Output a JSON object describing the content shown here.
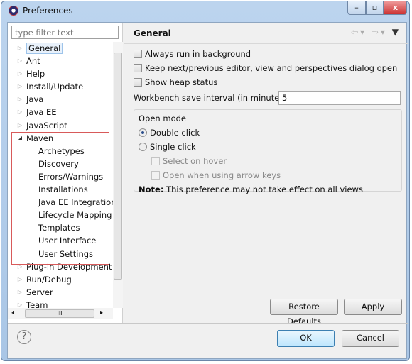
{
  "window": {
    "title": "Preferences",
    "minimize": "–",
    "maximize": "▫",
    "close": "x"
  },
  "filter": {
    "placeholder": "type filter text"
  },
  "tree": [
    {
      "label": "General",
      "level": 0,
      "expanded": false,
      "selected": true
    },
    {
      "label": "Ant",
      "level": 0,
      "expanded": false
    },
    {
      "label": "Help",
      "level": 0,
      "expanded": false
    },
    {
      "label": "Install/Update",
      "level": 0,
      "expanded": false
    },
    {
      "label": "Java",
      "level": 0,
      "expanded": false
    },
    {
      "label": "Java EE",
      "level": 0,
      "expanded": false
    },
    {
      "label": "JavaScript",
      "level": 0,
      "expanded": false
    },
    {
      "label": "Maven",
      "level": 0,
      "expanded": true
    },
    {
      "label": "Archetypes",
      "level": 1
    },
    {
      "label": "Discovery",
      "level": 1
    },
    {
      "label": "Errors/Warnings",
      "level": 1
    },
    {
      "label": "Installations",
      "level": 1
    },
    {
      "label": "Java EE Integration",
      "level": 1
    },
    {
      "label": "Lifecycle Mapping",
      "level": 1
    },
    {
      "label": "Templates",
      "level": 1
    },
    {
      "label": "User Interface",
      "level": 1
    },
    {
      "label": "User Settings",
      "level": 1
    },
    {
      "label": "Plug-in Development",
      "level": 0,
      "expanded": false
    },
    {
      "label": "Run/Debug",
      "level": 0,
      "expanded": false
    },
    {
      "label": "Server",
      "level": 0,
      "expanded": false
    },
    {
      "label": "Team",
      "level": 0,
      "expanded": false
    }
  ],
  "page": {
    "title": "General",
    "always_run_bg": "Always run in background",
    "keep_editor": "Keep next/previous editor, view and perspectives dialog open",
    "show_heap": "Show heap status",
    "save_interval_label": "Workbench save interval (in minutes):",
    "save_interval_value": "5",
    "open_mode": {
      "legend": "Open mode",
      "double": "Double click",
      "single": "Single click",
      "selected": "Double click",
      "select_hover": "Select on hover",
      "arrow_keys": "Open when using arrow keys"
    },
    "note_bold": "Note:",
    "note_text": " This preference may not take effect on all views"
  },
  "buttons": {
    "restore": "Restore Defaults",
    "apply": "Apply",
    "ok": "OK",
    "cancel": "Cancel",
    "help": "?"
  },
  "highlight_color": "#d85a5a"
}
